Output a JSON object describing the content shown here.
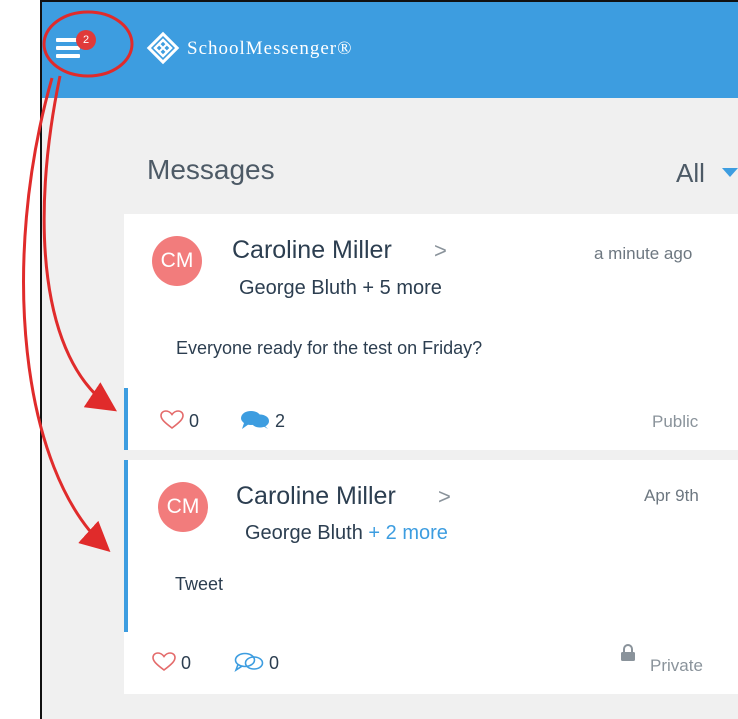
{
  "header": {
    "menu_badge": "2",
    "brand_name": "SchoolMessenger®",
    "logo_icon": "school-messenger-logo-icon",
    "menu_icon": "hamburger-menu-icon"
  },
  "messages": {
    "title": "Messages",
    "filter_label": "All",
    "items": [
      {
        "avatar": "CM",
        "sender": "Caroline Miller",
        "recipients_name": "George Bluth",
        "recipients_more": " + 5 more",
        "time": "a minute ago",
        "body": "Everyone ready for the test on Friday?",
        "likes": "0",
        "comments": "2",
        "visibility": "Public"
      },
      {
        "avatar": "CM",
        "sender": "Caroline Miller",
        "recipients_name": "George Bluth",
        "recipients_more": " + 2 more",
        "time": "Apr 9th",
        "body": "Tweet",
        "likes": "0",
        "comments": "0",
        "visibility": "Private"
      }
    ]
  },
  "colors": {
    "header_blue": "#3d9de0",
    "avatar_red": "#f27c7c",
    "annotation_red": "#e02b2b",
    "badge_red": "#e03a3a"
  }
}
